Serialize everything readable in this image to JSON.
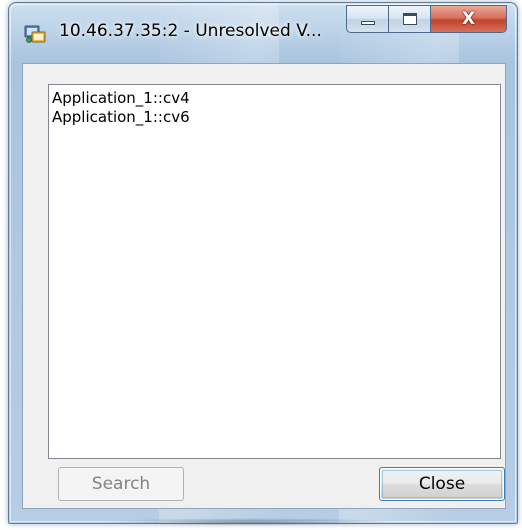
{
  "window": {
    "title": "10.46.37.35:2 - Unresolved V...",
    "app_icon": "network-app-icon",
    "caption_buttons": {
      "minimize_icon": "minimize-icon",
      "maximize_icon": "maximize-icon",
      "close_icon": "close-icon",
      "close_glyph": "X"
    }
  },
  "list": {
    "items": [
      "Application_1::cv4",
      "Application_1::cv6"
    ]
  },
  "buttons": {
    "search_label": "Search",
    "search_enabled": false,
    "close_label": "Close"
  },
  "colors": {
    "close_button_red": "#c2432b",
    "default_button_border": "#3c7fb1",
    "disabled_text": "#838383"
  }
}
